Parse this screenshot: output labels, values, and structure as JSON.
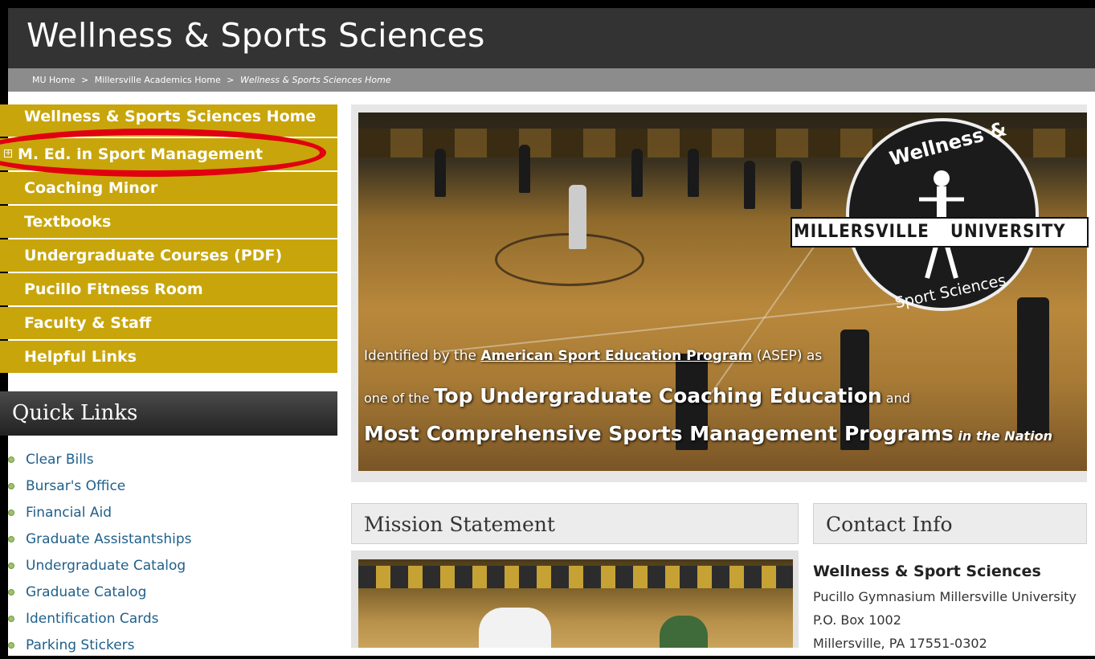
{
  "site": {
    "title": "Wellness & Sports Sciences"
  },
  "breadcrumb": [
    "MU Home",
    "Millersville Academics Home",
    "Wellness & Sports Sciences Home"
  ],
  "breadcrumb_separator": ">",
  "sidebar": {
    "items": [
      {
        "label": "Wellness & Sports Sciences Home"
      },
      {
        "label": "M. Ed. in Sport Management",
        "expand_icon": "plus-box-icon",
        "highlighted": true
      },
      {
        "label": "Coaching Minor"
      },
      {
        "label": "Textbooks"
      },
      {
        "label": "Undergraduate Courses (PDF)"
      },
      {
        "label": "Pucillo Fitness Room"
      },
      {
        "label": "Faculty & Staff"
      },
      {
        "label": "Helpful Links"
      }
    ]
  },
  "quick_links": {
    "title": "Quick Links",
    "items": [
      "Clear Bills",
      "Bursar's Office",
      "Financial Aid",
      "Graduate Assistantships",
      "Undergraduate Catalog",
      "Graduate Catalog",
      "Identification Cards",
      "Parking Stickers"
    ]
  },
  "hero": {
    "logo": {
      "top_text": "Wellness &",
      "banner_left": "MILLERSVILLE",
      "banner_right": "UNIVERSITY",
      "bottom_text": "Sport Sciences"
    },
    "line1_pre": "Identified by the ",
    "line1_link": "American Sport Education Program",
    "line1_post": " (ASEP) as",
    "line2_pre": "one of the ",
    "line2_big1": "Top Undergraduate Coaching Education",
    "line2_post": " and",
    "line3_big": "Most Comprehensive Sports Management Programs",
    "line3_small": " in the Nation"
  },
  "mission": {
    "title": "Mission Statement"
  },
  "contact": {
    "title": "Contact Info",
    "name": "Wellness & Sport Sciences",
    "line1": "Pucillo Gymnasium Millersville University",
    "line2": "P.O. Box 1002",
    "line3": "Millersville, PA 17551-0302"
  },
  "colors": {
    "topbar": "#333333",
    "breadcrumb_bar": "#8c8c8c",
    "nav_gold": "#c8a50b",
    "annotation_red": "#e0000f",
    "link_blue": "#1f5f8a",
    "bullet_green": "#9fc06e"
  }
}
